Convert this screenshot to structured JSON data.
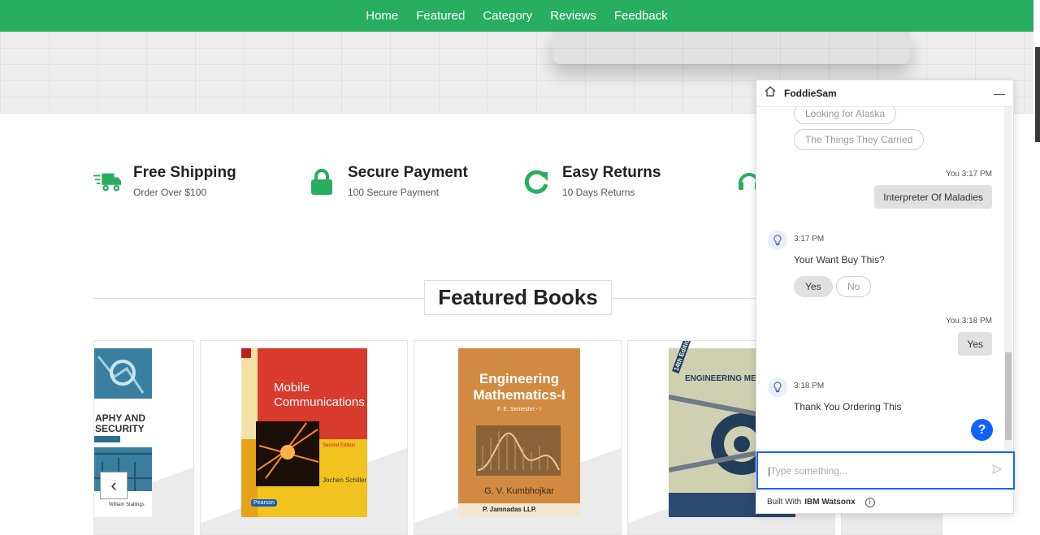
{
  "nav": {
    "items": [
      "Home",
      "Featured",
      "Category",
      "Reviews",
      "Feedback"
    ]
  },
  "features": [
    {
      "title": "Free Shipping",
      "subtitle": "Order Over $100",
      "icon": "truck-icon"
    },
    {
      "title": "Secure Payment",
      "subtitle": "100 Secure Payment",
      "icon": "lock-icon"
    },
    {
      "title": "Easy Returns",
      "subtitle": "10 Days Returns",
      "icon": "redo-icon"
    },
    {
      "title": "",
      "subtitle": "",
      "icon": "headset-icon"
    }
  ],
  "featured": {
    "title": "Featured Books",
    "books": [
      {
        "title_line1": "APHY AND",
        "title_line2": "SECURITY",
        "author": "William Stallings"
      },
      {
        "title_line1": "Mobile",
        "title_line2": "Communications",
        "author": "Jochen Schiller",
        "badge": "Second Edition",
        "publisher": "Pearson"
      },
      {
        "title_line1": "Engineering",
        "title_line2": "Mathematics-I",
        "sub": "F. E. Semester - I",
        "author": "G. V. Kumbhojkar",
        "publisher": "P. Jamnadas LLP."
      },
      {
        "title_line1": "ENGINEERING MECH",
        "edition": "14th Edition"
      }
    ]
  },
  "chat": {
    "title": "FoddieSam",
    "options_top": [
      "Looking for Alaska",
      "The Things They Carried"
    ],
    "messages": [
      {
        "stamp": "You 3:17 PM",
        "text": "Interpreter Of Maladies"
      },
      {
        "stamp": "3:17 PM",
        "text": "Your Want Buy This?"
      },
      {
        "stamp": "You 3:18 PM",
        "text": "Yes"
      },
      {
        "stamp": "3:18 PM",
        "text": "Thank You Ordering This"
      }
    ],
    "yes_label": "Yes",
    "no_label": "No",
    "input_placeholder": "Type something...",
    "footer_built": "Built With",
    "footer_brand": "IBM Watsonx",
    "help_label": "?"
  },
  "colors": {
    "brand": "#27ae60",
    "chat_accent": "#0f62fe"
  }
}
